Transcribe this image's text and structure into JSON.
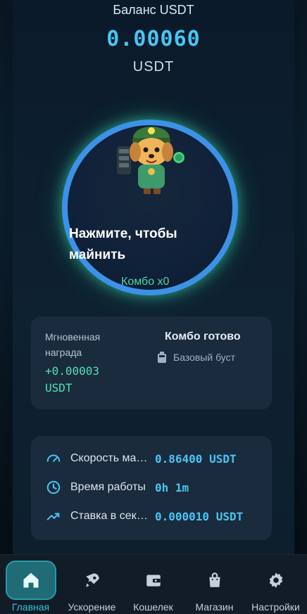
{
  "balance": {
    "title": "Баланс USDT",
    "value": "0.00060",
    "unit": "USDT"
  },
  "mine": {
    "tap_label": "Нажмите, чтобы майнить",
    "combo": "Комбо x0"
  },
  "reward_card": {
    "instant_label": "Мгновенная награда",
    "instant_value": "+0.00003 USDT",
    "combo_ready": "Комбо готово",
    "boost_label": "Базовый буст"
  },
  "stats": [
    {
      "label": "Скорость майнинга",
      "value": "0.86400 USDT",
      "icon": "speedometer-icon"
    },
    {
      "label": "Время работы",
      "value": "0h 1m",
      "icon": "clock-icon"
    },
    {
      "label": "Ставка в секунду",
      "value": "0.000010 USDT",
      "icon": "trend-up-icon"
    }
  ],
  "nav": [
    {
      "label": "Главная",
      "icon": "home-icon",
      "active": true
    },
    {
      "label": "Ускорение",
      "icon": "rocket-icon",
      "active": false
    },
    {
      "label": "Кошелек",
      "icon": "wallet-icon",
      "active": false
    },
    {
      "label": "Магазин",
      "icon": "shopping-bag-icon",
      "active": false
    },
    {
      "label": "Настройки",
      "icon": "gear-icon",
      "active": false
    }
  ],
  "colors": {
    "accent_blue": "#49c5f2",
    "accent_green": "#4ee2b0",
    "ring_blue": "#3c92e6"
  }
}
